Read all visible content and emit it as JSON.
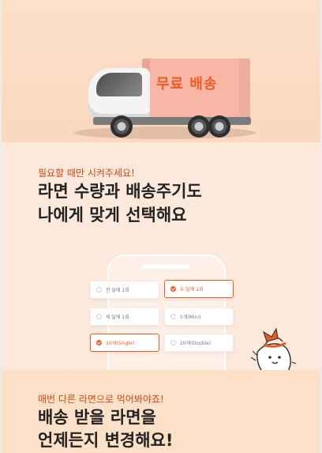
{
  "hero": {
    "truck_label": "무료 배송"
  },
  "section1": {
    "eyebrow": "필요할 때만 시켜주세요!",
    "headline_line1": "라면 수량과 배송주기도",
    "headline_line2": "나에게 맞게 선택해요"
  },
  "options": [
    {
      "label": "한 달에 1회",
      "selected": false
    },
    {
      "label": "두 달에 1회",
      "selected": true
    },
    {
      "label": "세 달에 1회",
      "selected": false
    },
    {
      "label": "5개(Mini)",
      "selected": false
    },
    {
      "label": "10개(Single)",
      "selected": true
    },
    {
      "label": "20개(Double)",
      "selected": false
    }
  ],
  "section2": {
    "eyebrow": "매번 다른 라면으로 먹어봐야죠!",
    "headline_line1": "배송 받을 라면을",
    "headline_line2": "언제든지 변경해요!"
  },
  "colors": {
    "accent": "#ef5a1e",
    "background": "#fde9db"
  }
}
